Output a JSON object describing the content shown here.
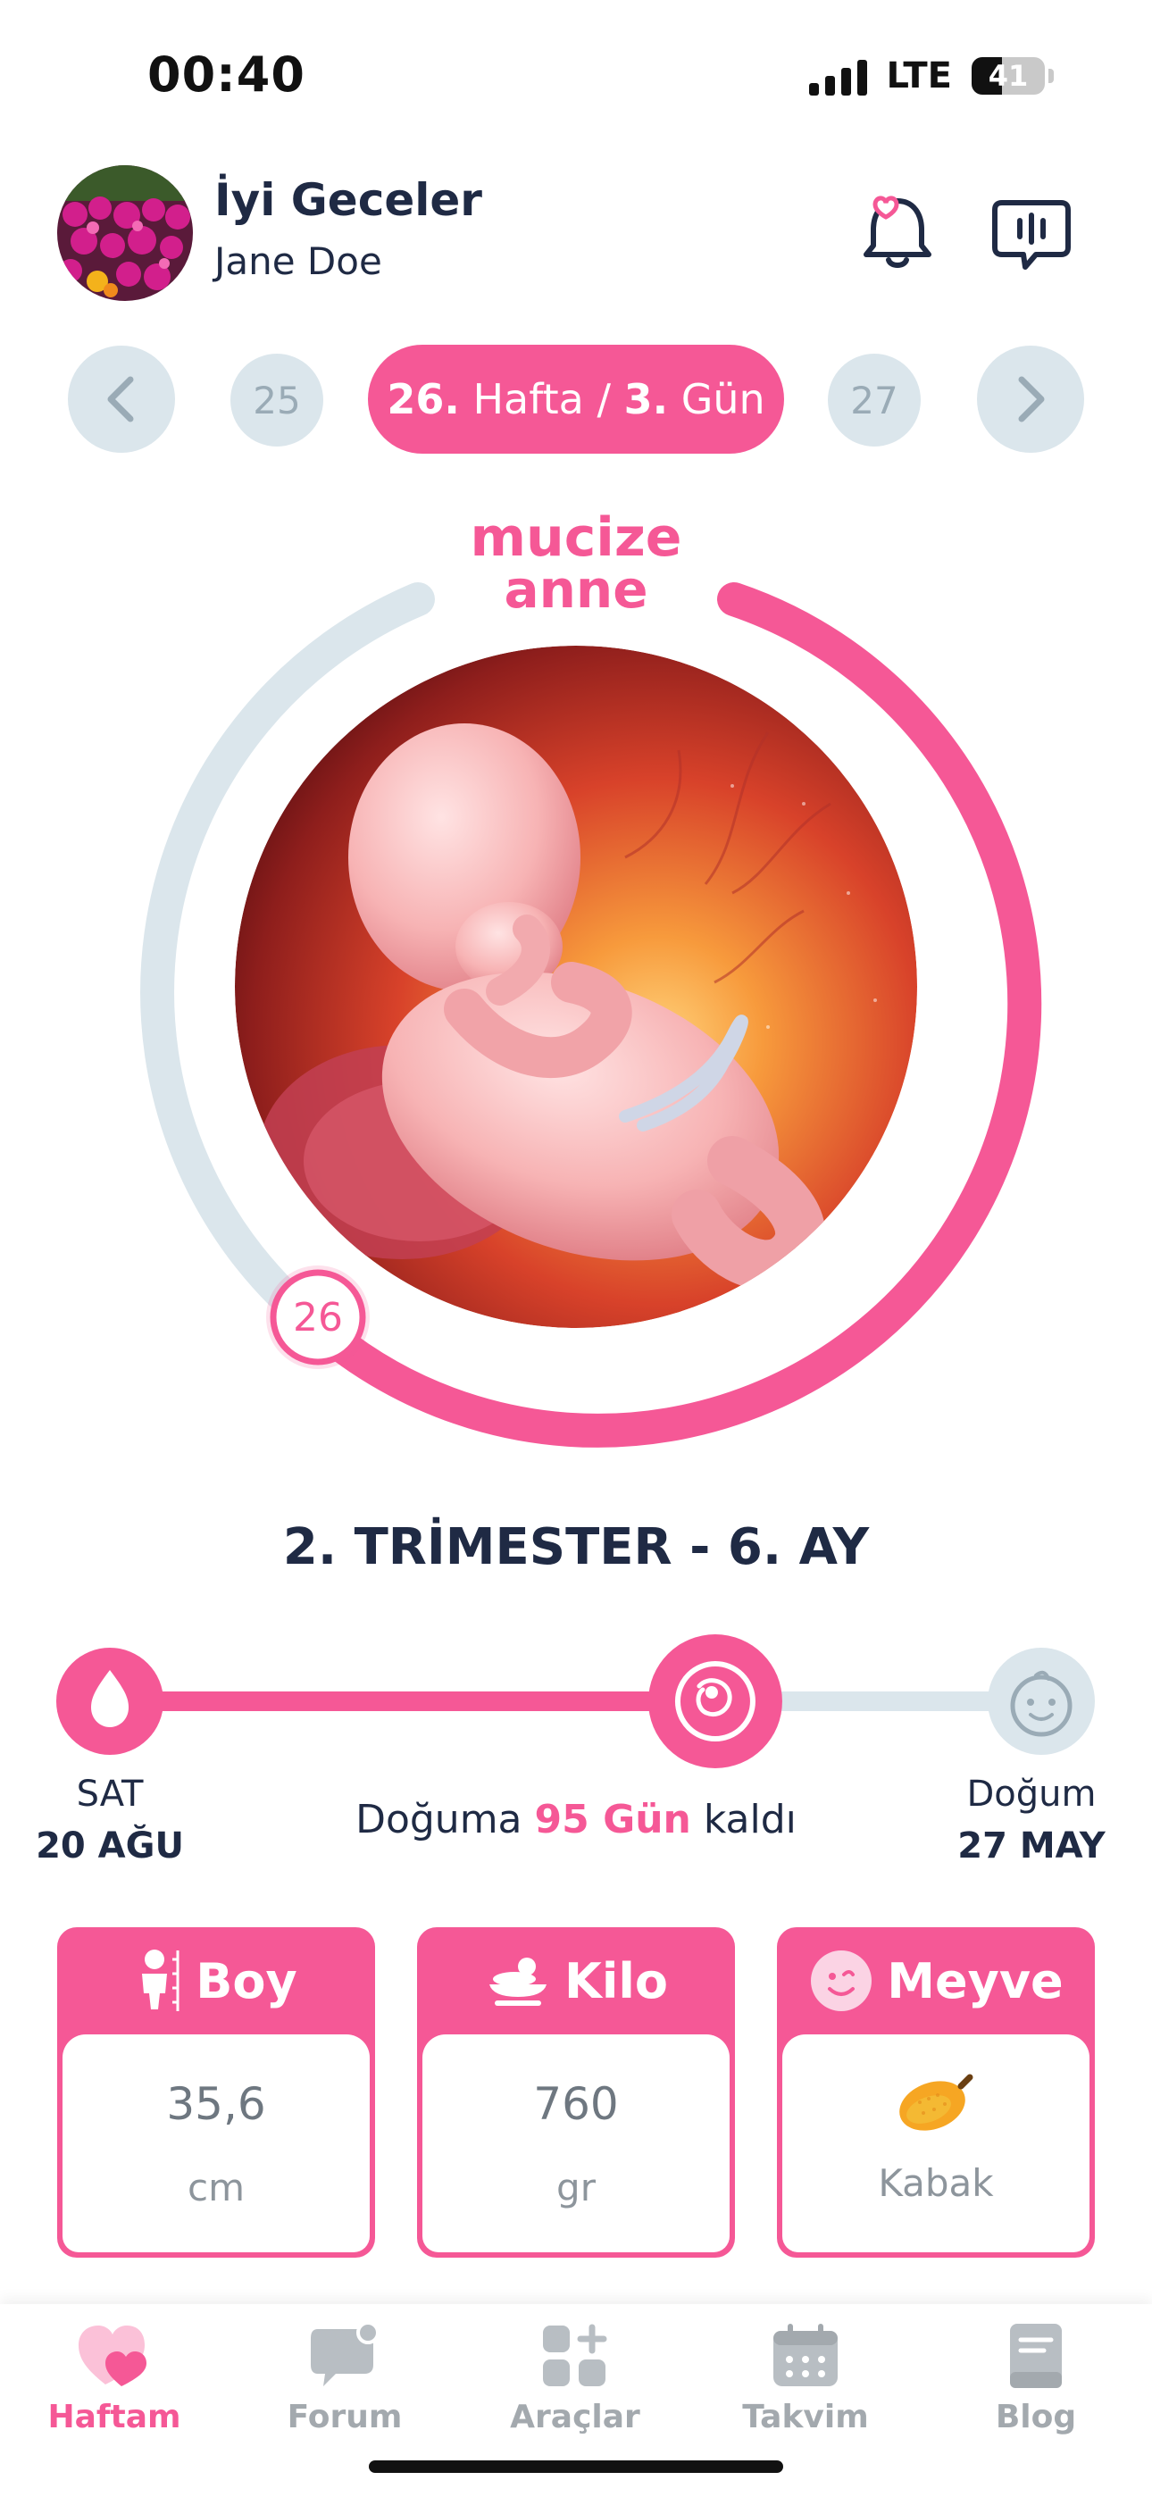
{
  "status_bar": {
    "time": "00:40",
    "network": "LTE",
    "battery": "41"
  },
  "header": {
    "greeting": "İyi Geceler",
    "user_name": "Jane Doe"
  },
  "week_nav": {
    "prev_week": "25",
    "next_week": "27",
    "current_week": "26.",
    "week_word": "Hafta /",
    "current_day": "3.",
    "day_word": "Gün"
  },
  "brand": {
    "logo_line1": "mucize",
    "logo_line2": "anne"
  },
  "progress": {
    "week_badge": "26",
    "fraction": 0.65,
    "color_active": "#f55896",
    "color_track": "#dbe6ec"
  },
  "trimester": "2. TRİMESTER - 6. AY",
  "timeline": {
    "start_label": "SAT",
    "start_date": "20 AĞU",
    "countdown_prefix": "Doğuma",
    "countdown_value": "95 Gün",
    "countdown_suffix": "kaldı",
    "end_label": "Doğum",
    "end_date": "27 MAY",
    "fraction": 0.65
  },
  "cards": {
    "boy": {
      "title": "Boy",
      "value": "35,6",
      "unit": "cm"
    },
    "kilo": {
      "title": "Kilo",
      "value": "760",
      "unit": "gr"
    },
    "meyve": {
      "title": "Meyve",
      "value": "Kabak"
    }
  },
  "bottom_nav": [
    {
      "label": "Haftam",
      "icon": "heart-icon",
      "active": true
    },
    {
      "label": "Forum",
      "icon": "chat-bubble-icon",
      "active": false
    },
    {
      "label": "Araçlar",
      "icon": "tools-grid-icon",
      "active": false
    },
    {
      "label": "Takvim",
      "icon": "calendar-icon",
      "active": false
    },
    {
      "label": "Blog",
      "icon": "book-icon",
      "active": false
    }
  ],
  "colors": {
    "accent": "#f55896",
    "text_dark": "#1f2a44",
    "muted": "#a3a9ae"
  }
}
